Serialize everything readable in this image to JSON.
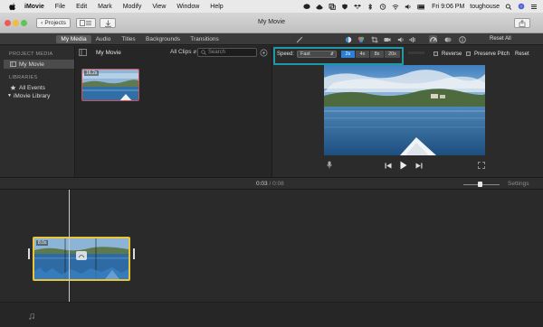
{
  "menubar": {
    "app_name": "iMovie",
    "menus": [
      "File",
      "Edit",
      "Mark",
      "Modify",
      "View",
      "Window",
      "Help"
    ],
    "clock": "Fri 9:06 PM",
    "user": "toughouse"
  },
  "toolbar": {
    "projects_label": "Projects",
    "window_title": "My Movie"
  },
  "tabs": [
    "My Media",
    "Audio",
    "Titles",
    "Backgrounds",
    "Transitions"
  ],
  "reset_all_label": "Reset All",
  "sidebar": {
    "project_media_heading": "PROJECT MEDIA",
    "project_item": "My Movie",
    "libraries_heading": "LIBRARIES",
    "all_events": "All Events",
    "library": "iMovie Library"
  },
  "browser": {
    "title": "My Movie",
    "filter": "All Clips",
    "search_placeholder": "Search",
    "clip_duration": "16.2s"
  },
  "speed": {
    "label": "Speed:",
    "value": "Fast",
    "options": [
      "2x",
      "4x",
      "8x",
      "20x"
    ],
    "selected": "2x",
    "reverse_label": "Reverse",
    "preserve_pitch_label": "Preserve Pitch",
    "reset_label": "Reset"
  },
  "timeline": {
    "current_time": "0:03",
    "total_time": "0:08",
    "settings_label": "Settings",
    "clip_duration": "8.0s",
    "zoom_level": 0.45
  },
  "colors": {
    "highlight": "#1d9aa6",
    "speed_active": "#2e7fd6",
    "clip_selection": "#e9c53a"
  }
}
